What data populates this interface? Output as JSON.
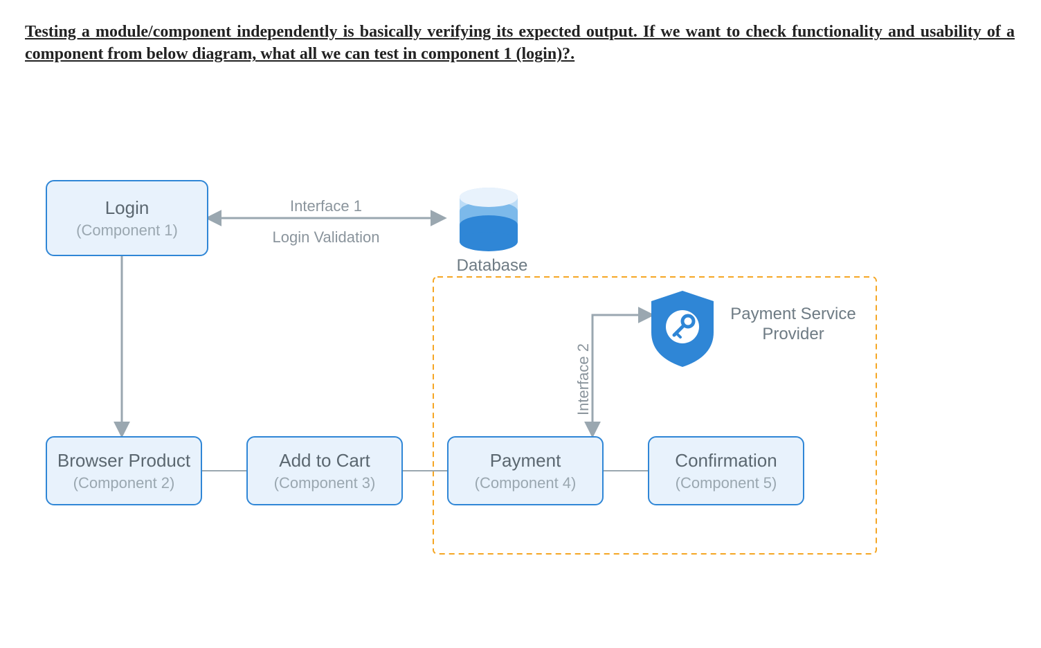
{
  "question_text": "Testing a module/component independently is basically verifying its expected output. If we want to check functionality and usability of a component from below diagram, what all we can test in component 1 (login)?.",
  "diagram": {
    "login": {
      "title": "Login",
      "sub": "(Component 1)"
    },
    "browser_product": {
      "title": "Browser Product",
      "sub": "(Component 2)"
    },
    "add_to_cart": {
      "title": "Add to Cart",
      "sub": "(Component 3)"
    },
    "payment": {
      "title": "Payment",
      "sub": "(Component 4)"
    },
    "confirmation": {
      "title": "Confirmation",
      "sub": "(Component 5)"
    },
    "interface1_line1": "Interface 1",
    "interface1_line2": "Login Validation",
    "database_label": "Database",
    "interface2_label": "Interface 2",
    "psp_label_line1": "Payment Service",
    "psp_label_line2": "Provider"
  }
}
